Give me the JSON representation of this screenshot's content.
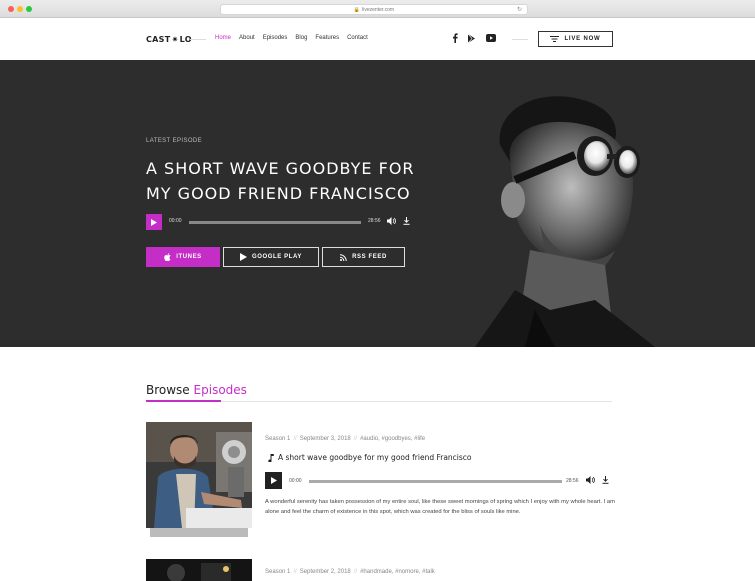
{
  "browser": {
    "url": "livezenter.com"
  },
  "header": {
    "logo": "CAST ✷ LO",
    "nav": [
      "Home",
      "About",
      "Episodes",
      "Blog",
      "Features",
      "Contact"
    ],
    "active_nav": "Home",
    "live_button": "LIVE NOW"
  },
  "hero": {
    "kicker": "LATEST EPISODE",
    "title": "A SHORT WAVE GOODBYE FOR MY GOOD FRIEND FRANCISCO",
    "player": {
      "current": "00:00",
      "duration": "28:56",
      "progress": 0
    },
    "buttons": {
      "itunes": "ITUNES",
      "google_play": "GOOGLE PLAY",
      "rss": "RSS FEED"
    }
  },
  "browse": {
    "title_prefix": "Browse",
    "title_accent": "Episodes"
  },
  "episodes": [
    {
      "season": "Season 1",
      "date": "September 3, 2018",
      "tags": "#audio, #goodbyes, #life",
      "title": "A short wave goodbye for my good friend Francisco",
      "player": {
        "current": "00:00",
        "duration": "28:56"
      },
      "description": "A wonderful serenity has taken possession of my entire soul, like these sweet mornings of spring which I enjoy with my whole heart. I am alone and feel the charm of existence in this spot, which was created for the bliss of souls like mine."
    },
    {
      "season": "Season 1",
      "date": "September 2, 2018",
      "tags": "#handmade, #nomore, #talk"
    }
  ],
  "colors": {
    "accent": "#c52ec6",
    "hero_bg": "#2d2d2d"
  },
  "icons": [
    "facebook-icon",
    "google-play-icon",
    "youtube-icon",
    "menu-icon",
    "play-icon",
    "volume-icon",
    "download-icon",
    "apple-icon",
    "rss-icon",
    "music-note-icon"
  ]
}
